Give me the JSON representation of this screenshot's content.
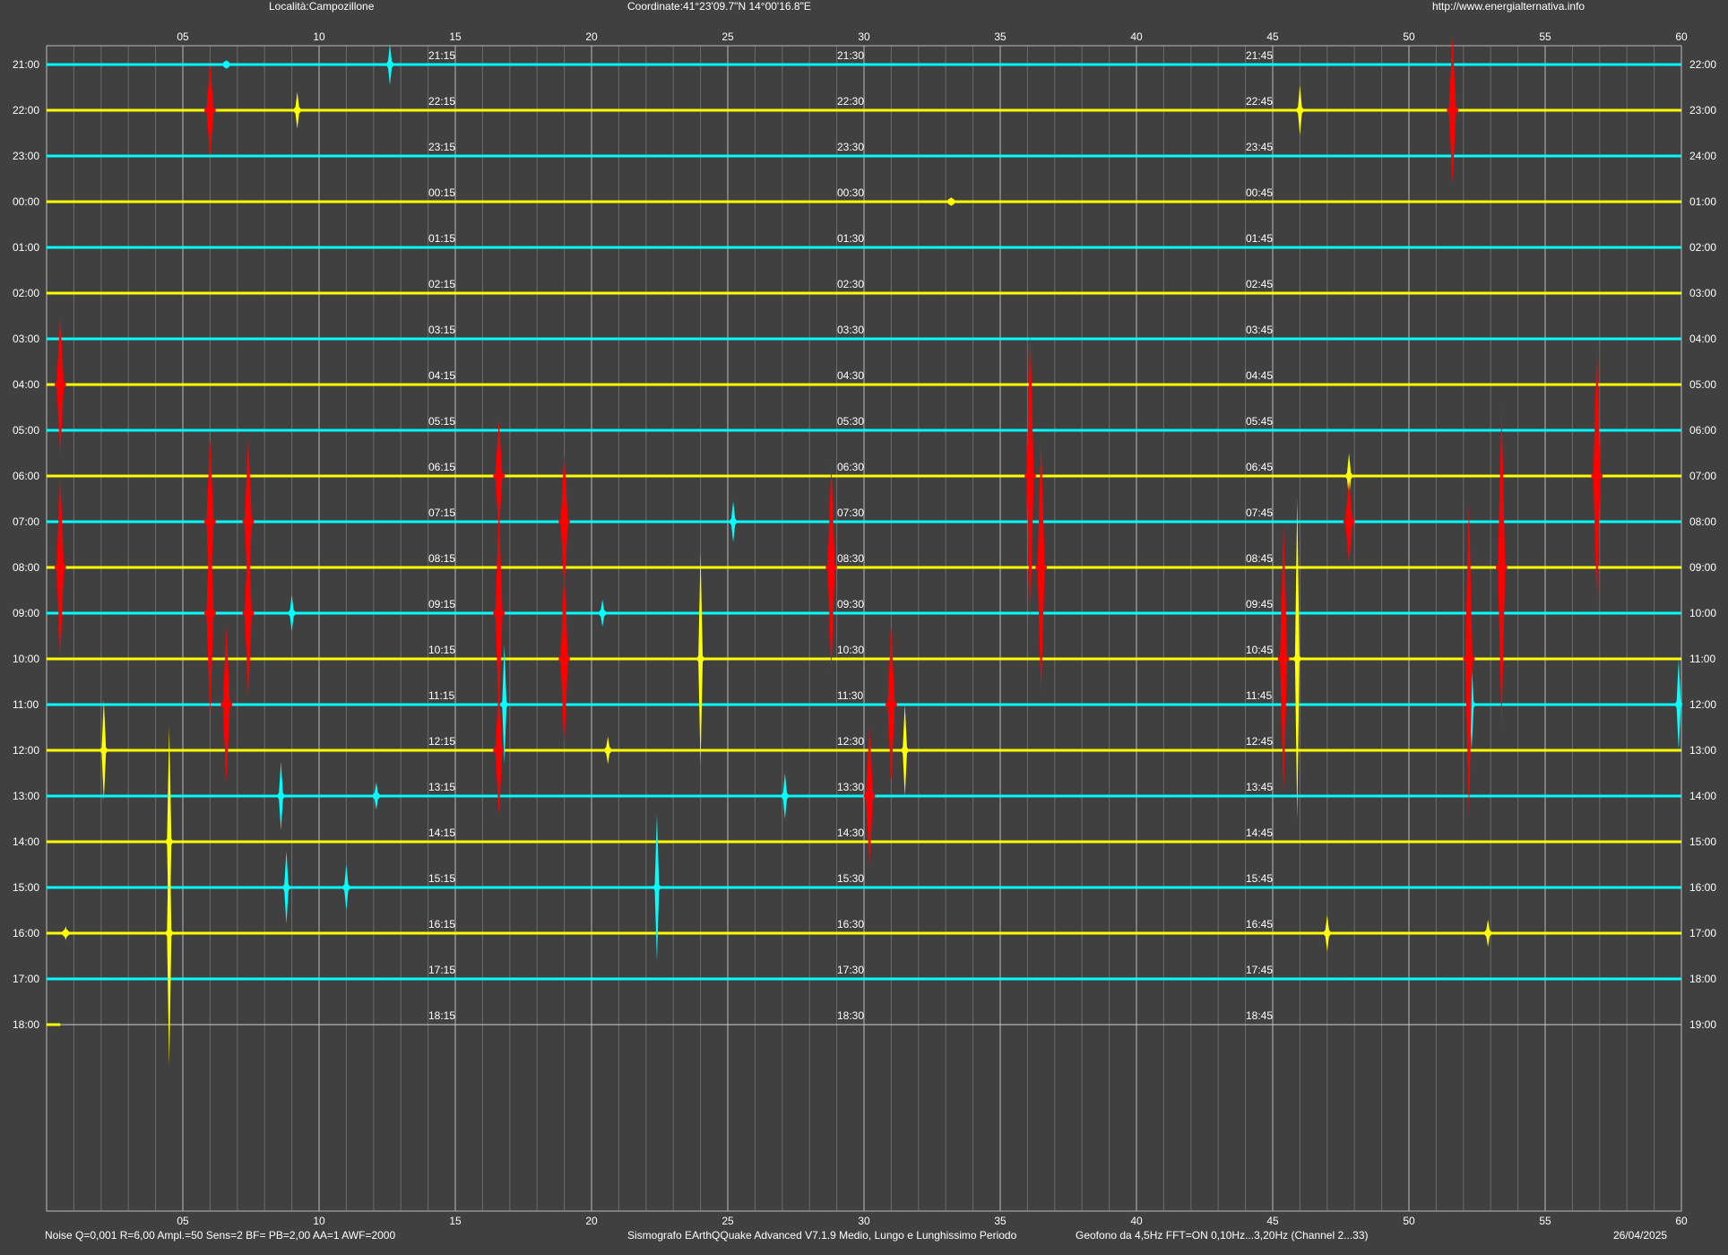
{
  "header": {
    "location": "Località:Campozillone",
    "coordinates": "Coordinate:41°23'09.7\"N 14°00'16.8\"E",
    "url": "http://www.energialternativa.info"
  },
  "footer": {
    "settings": "Noise Q=0,001 R=6,00 Ampl.=50 Sens=2 BF= PB=2,00 AA=1 AWF=2000",
    "software": "Sismografo  EArthQQuake Advanced V7.1.9  Medio, Lungo e Lunghissimo Periodo",
    "sensor": "Geofono da 4,5Hz FFT=ON 0,10Hz...3,20Hz      (Channel 2...33)",
    "date": "26/04/2025"
  },
  "colors": {
    "background": "#404040",
    "grid": "#9a9a9a",
    "trace_cyan": "#00ffff",
    "trace_yellow": "#ffff00",
    "event_red": "#ff0000",
    "text": "#ffffff"
  },
  "chart_data": {
    "type": "line",
    "x_ticks": [
      "05",
      "10",
      "15",
      "20",
      "25",
      "30",
      "35",
      "40",
      "45",
      "50",
      "55",
      "60"
    ],
    "x_range_minutes": [
      0,
      60
    ],
    "left_hour_labels": [
      "21:00",
      "22:00",
      "23:00",
      "00:00",
      "01:00",
      "02:00",
      "03:00",
      "04:00",
      "05:00",
      "06:00",
      "07:00",
      "08:00",
      "09:00",
      "10:00",
      "11:00",
      "12:00",
      "13:00",
      "14:00",
      "15:00",
      "16:00",
      "17:00",
      "18:00"
    ],
    "right_hour_labels": [
      "22:00",
      "23:00",
      "24:00",
      "01:00",
      "02:00",
      "03:00",
      "04:00",
      "05:00",
      "06:00",
      "07:00",
      "08:00",
      "09:00",
      "10:00",
      "11:00",
      "12:00",
      "13:00",
      "14:00",
      "15:00",
      "16:00",
      "17:00",
      "18:00",
      "19:00"
    ],
    "quarter_labels": [
      [
        "21:15",
        "21:30",
        "21:45"
      ],
      [
        "22:15",
        "22:30",
        "22:45"
      ],
      [
        "23:15",
        "23:30",
        "23:45"
      ],
      [
        "00:15",
        "00:30",
        "00:45"
      ],
      [
        "01:15",
        "01:30",
        "01:45"
      ],
      [
        "02:15",
        "02:30",
        "02:45"
      ],
      [
        "03:15",
        "03:30",
        "03:45"
      ],
      [
        "04:15",
        "04:30",
        "04:45"
      ],
      [
        "05:15",
        "05:30",
        "05:45"
      ],
      [
        "06:15",
        "06:30",
        "06:45"
      ],
      [
        "07:15",
        "07:30",
        "07:45"
      ],
      [
        "08:15",
        "08:30",
        "08:45"
      ],
      [
        "09:15",
        "09:30",
        "09:45"
      ],
      [
        "10:15",
        "10:30",
        "10:45"
      ],
      [
        "11:15",
        "11:30",
        "11:45"
      ],
      [
        "12:15",
        "12:30",
        "12:45"
      ],
      [
        "13:15",
        "13:30",
        "13:45"
      ],
      [
        "14:15",
        "14:30",
        "14:45"
      ],
      [
        "15:15",
        "15:30",
        "15:45"
      ],
      [
        "16:15",
        "16:30",
        "16:45"
      ],
      [
        "17:15",
        "17:30",
        "17:45"
      ],
      [
        "18:15",
        "18:30",
        "18:45"
      ]
    ],
    "row_colors": [
      "cyan",
      "yellow",
      "cyan",
      "yellow",
      "cyan",
      "yellow",
      "cyan",
      "yellow",
      "cyan",
      "yellow",
      "cyan",
      "yellow",
      "cyan",
      "yellow",
      "cyan",
      "yellow",
      "cyan",
      "yellow",
      "cyan",
      "yellow",
      "cyan",
      "yellow"
    ],
    "last_row_end_minute": 0.5,
    "events": [
      {
        "row": 0,
        "minute": 12.6,
        "amp": 0.45,
        "color": "cyan"
      },
      {
        "row": 0,
        "minute": 6.6,
        "amp": 0.1,
        "color": "cyan"
      },
      {
        "row": 1,
        "minute": 6.0,
        "amp": 1.0,
        "color": "red"
      },
      {
        "row": 1,
        "minute": 9.2,
        "amp": 0.4,
        "color": "yellow"
      },
      {
        "row": 1,
        "minute": 46.0,
        "amp": 0.55,
        "color": "yellow"
      },
      {
        "row": 1,
        "minute": 51.6,
        "amp": 1.6,
        "color": "red"
      },
      {
        "row": 3,
        "minute": 33.2,
        "amp": 0.1,
        "color": "yellow"
      },
      {
        "row": 7,
        "minute": 0.5,
        "amp": 1.5,
        "color": "red"
      },
      {
        "row": 11,
        "minute": 0.5,
        "amp": 2.0,
        "color": "red"
      },
      {
        "row": 10,
        "minute": 6.0,
        "amp": 1.8,
        "color": "red"
      },
      {
        "row": 12,
        "minute": 6.0,
        "amp": 2.2,
        "color": "red"
      },
      {
        "row": 10,
        "minute": 7.4,
        "amp": 1.8,
        "color": "red"
      },
      {
        "row": 12,
        "minute": 7.4,
        "amp": 1.8,
        "color": "red"
      },
      {
        "row": 14,
        "minute": 6.6,
        "amp": 1.7,
        "color": "red"
      },
      {
        "row": 12,
        "minute": 9.0,
        "amp": 0.4,
        "color": "cyan"
      },
      {
        "row": 9,
        "minute": 16.6,
        "amp": 1.2,
        "color": "red"
      },
      {
        "row": 12,
        "minute": 16.6,
        "amp": 2.2,
        "color": "red"
      },
      {
        "row": 15,
        "minute": 16.6,
        "amp": 1.4,
        "color": "red"
      },
      {
        "row": 14,
        "minute": 16.8,
        "amp": 1.3,
        "color": "cyan"
      },
      {
        "row": 10,
        "minute": 19.0,
        "amp": 1.5,
        "color": "red"
      },
      {
        "row": 13,
        "minute": 19.0,
        "amp": 2.0,
        "color": "red"
      },
      {
        "row": 10,
        "minute": 25.2,
        "amp": 0.45,
        "color": "cyan"
      },
      {
        "row": 13,
        "minute": 24.0,
        "amp": 2.3,
        "color": "yellow"
      },
      {
        "row": 12,
        "minute": 20.4,
        "amp": 0.3,
        "color": "cyan"
      },
      {
        "row": 15,
        "minute": 20.6,
        "amp": 0.3,
        "color": "yellow"
      },
      {
        "row": 11,
        "minute": 28.8,
        "amp": 2.3,
        "color": "red"
      },
      {
        "row": 14,
        "minute": 31.0,
        "amp": 1.7,
        "color": "red"
      },
      {
        "row": 15,
        "minute": 31.5,
        "amp": 1.0,
        "color": "yellow"
      },
      {
        "row": 16,
        "minute": 30.2,
        "amp": 1.5,
        "color": "red"
      },
      {
        "row": 16,
        "minute": 27.1,
        "amp": 0.5,
        "color": "cyan"
      },
      {
        "row": 9,
        "minute": 36.1,
        "amp": 3.2,
        "color": "red"
      },
      {
        "row": 11,
        "minute": 36.5,
        "amp": 2.8,
        "color": "red"
      },
      {
        "row": 9,
        "minute": 47.8,
        "amp": 0.5,
        "color": "yellow"
      },
      {
        "row": 10,
        "minute": 47.8,
        "amp": 0.9,
        "color": "red"
      },
      {
        "row": 13,
        "minute": 45.4,
        "amp": 2.9,
        "color": "red"
      },
      {
        "row": 13,
        "minute": 45.9,
        "amp": 3.5,
        "color": "yellow"
      },
      {
        "row": 14,
        "minute": 52.3,
        "amp": 1.0,
        "color": "cyan"
      },
      {
        "row": 13,
        "minute": 52.2,
        "amp": 3.4,
        "color": "red"
      },
      {
        "row": 11,
        "minute": 53.4,
        "amp": 3.5,
        "color": "red"
      },
      {
        "row": 9,
        "minute": 56.9,
        "amp": 2.8,
        "color": "red"
      },
      {
        "row": 14,
        "minute": 59.9,
        "amp": 1.0,
        "color": "cyan"
      },
      {
        "row": 15,
        "minute": 2.1,
        "amp": 1.1,
        "color": "yellow"
      },
      {
        "row": 16,
        "minute": 8.6,
        "amp": 0.75,
        "color": "cyan"
      },
      {
        "row": 16,
        "minute": 12.1,
        "amp": 0.3,
        "color": "cyan"
      },
      {
        "row": 17,
        "minute": 4.5,
        "amp": 2.5,
        "color": "yellow"
      },
      {
        "row": 19,
        "minute": 4.5,
        "amp": 2.9,
        "color": "yellow"
      },
      {
        "row": 18,
        "minute": 8.8,
        "amp": 0.8,
        "color": "cyan"
      },
      {
        "row": 18,
        "minute": 11.0,
        "amp": 0.5,
        "color": "cyan"
      },
      {
        "row": 18,
        "minute": 22.4,
        "amp": 1.6,
        "color": "cyan"
      },
      {
        "row": 19,
        "minute": 47.0,
        "amp": 0.4,
        "color": "yellow"
      },
      {
        "row": 19,
        "minute": 52.9,
        "amp": 0.3,
        "color": "yellow"
      },
      {
        "row": 19,
        "minute": 0.7,
        "amp": 0.15,
        "color": "yellow"
      }
    ]
  }
}
